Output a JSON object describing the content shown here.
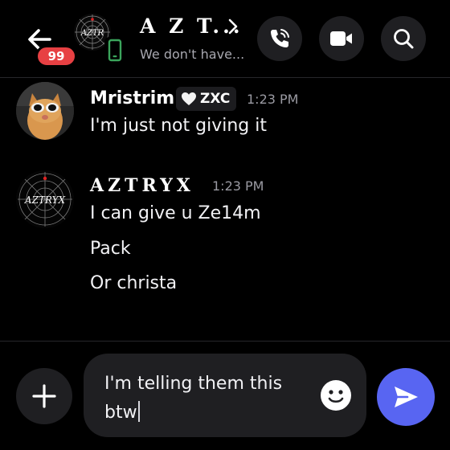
{
  "header": {
    "unread_count": "99",
    "title": "A Z T...",
    "subtitle": "We don't have...",
    "avatar_text": "AZTR",
    "icons": {
      "back": "arrow-left-icon",
      "chevron": "chevron-right-icon",
      "device": "mobile-phone-icon",
      "call": "phone-call-icon",
      "video": "video-camera-icon",
      "search": "search-icon"
    }
  },
  "messages": [
    {
      "author": "Mristrim",
      "tag": "ZXC",
      "tag_icon": "heart-icon",
      "time": "1:23 PM",
      "lines": [
        "I'm just not giving it"
      ]
    },
    {
      "author": "AZTRYX",
      "avatar_text": "AZTRYX",
      "time": "1:23 PM",
      "lines": [
        "I can give u Ze14m",
        "Pack",
        "Or christa"
      ]
    }
  ],
  "composer": {
    "line1": "I'm telling them this",
    "line2": "btw",
    "icons": {
      "add": "plus-icon",
      "emoji": "emoji-smile-icon",
      "send": "send-icon"
    }
  },
  "colors": {
    "background": "#000000",
    "surface": "#1f1f22",
    "badge": "#e74043",
    "send": "#5865f2",
    "device_icon": "#3ba55c",
    "muted_text": "#9a9aa2"
  }
}
